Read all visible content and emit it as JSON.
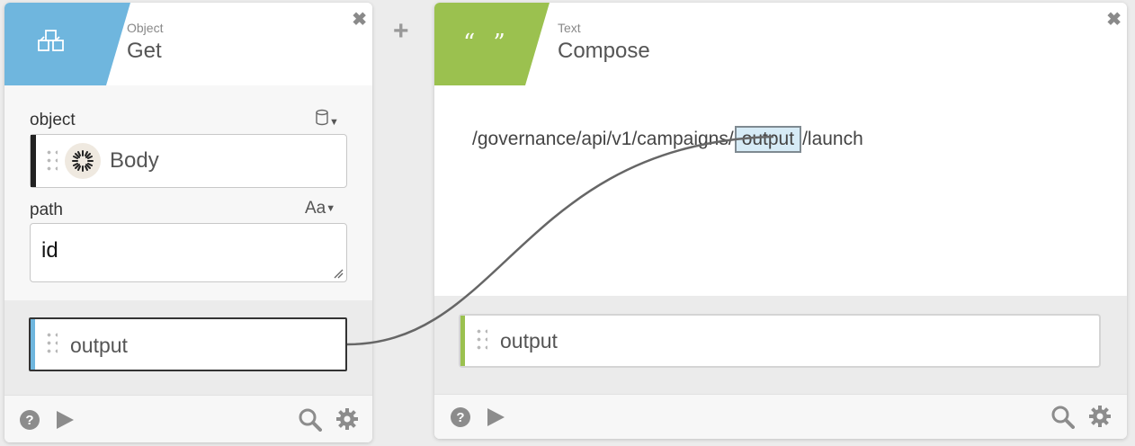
{
  "add_button_label": "+",
  "get_node": {
    "type_label": "Object",
    "title": "Get",
    "header_color": "#6fb6de",
    "icon": "cubes-icon",
    "inputs": {
      "object": {
        "label": "object",
        "type_icon": "database-icon",
        "value": "Body",
        "value_icon": "sunburst-icon"
      },
      "path": {
        "label": "path",
        "type_indicator": "Aa",
        "value": "id"
      }
    },
    "output": {
      "label": "output",
      "stripe_color": "#6fb6de"
    }
  },
  "compose_node": {
    "type_label": "Text",
    "title": "Compose",
    "header_color": "#9bc14f",
    "icon": "quotes-icon",
    "icon_text": "“ ”",
    "text_parts": {
      "before": "/governance/api/v1/campaigns/",
      "token": "output",
      "after": "/launch"
    },
    "output": {
      "label": "output",
      "stripe_color": "#9bc14f"
    }
  },
  "close_glyph": "✖",
  "footer_icons": [
    "help-icon",
    "play-icon",
    "search-icon",
    "gear-icon"
  ]
}
